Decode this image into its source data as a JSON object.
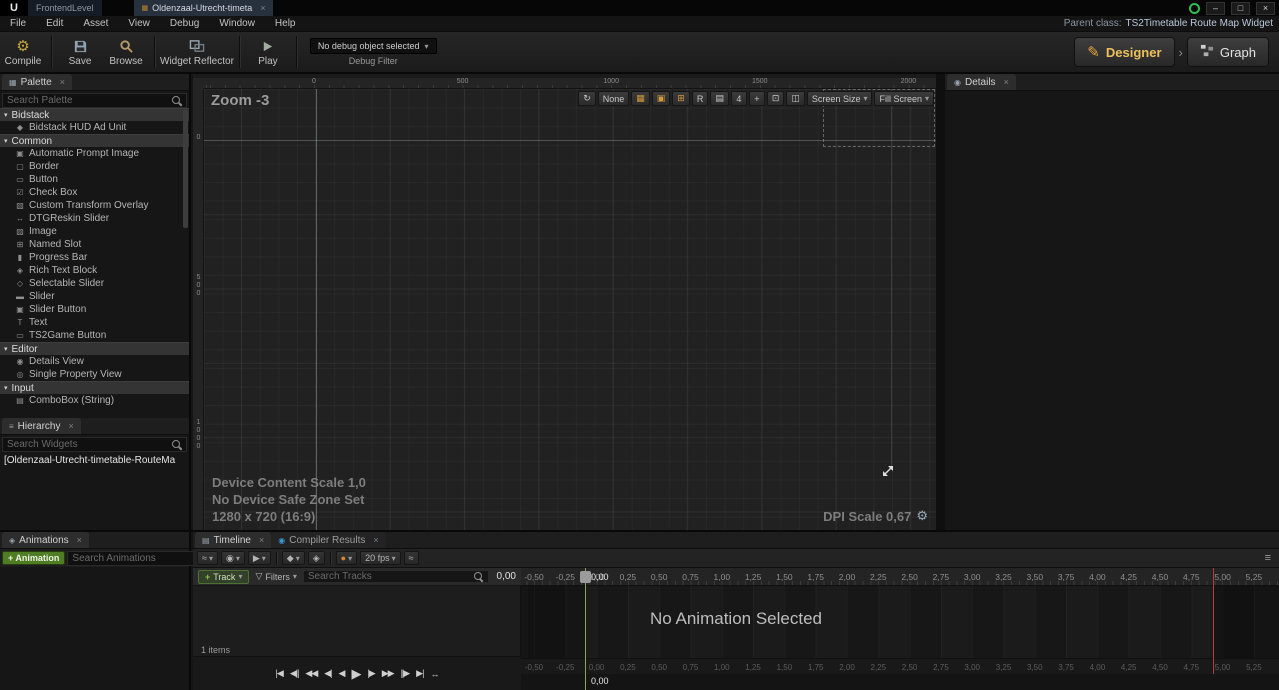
{
  "ui": {
    "caret": "▾",
    "close_glyph": "×",
    "tri": "▾",
    "plus": "+",
    "menu_glyph": "≡"
  },
  "titlebar": {
    "logo": "U",
    "tabs": [
      {
        "label": "FrontendLevel"
      },
      {
        "label": "Oldenzaal-Utrecht-timeta"
      }
    ],
    "window_controls": {
      "minimize": "–",
      "maximize": "□",
      "close": "×"
    }
  },
  "menubar": {
    "items": [
      "File",
      "Edit",
      "Asset",
      "View",
      "Debug",
      "Window",
      "Help"
    ],
    "parent_class_label": "Parent class:",
    "parent_class_value": "TS2Timetable Route Map Widget"
  },
  "toolbar": {
    "compile": "Compile",
    "save": "Save",
    "browse": "Browse",
    "widget_reflector": "Widget Reflector",
    "play": "Play",
    "debug_dropdown": "No debug object selected",
    "debug_filter": "Debug Filter",
    "designer": "Designer",
    "graph": "Graph"
  },
  "palette": {
    "tab": "Palette",
    "search_placeholder": "Search Palette",
    "groups": [
      {
        "label": "Bidstack",
        "items": [
          {
            "label": "Bidstack HUD Ad Unit",
            "glyph": "◆"
          }
        ]
      },
      {
        "label": "Common",
        "items": [
          {
            "label": "Automatic Prompt Image",
            "glyph": "▣"
          },
          {
            "label": "Border",
            "glyph": "▢"
          },
          {
            "label": "Button",
            "glyph": "▭"
          },
          {
            "label": "Check Box",
            "glyph": "☑"
          },
          {
            "label": "Custom Transform Overlay",
            "glyph": "▧"
          },
          {
            "label": "DTGReskin Slider",
            "glyph": "↔"
          },
          {
            "label": "Image",
            "glyph": "▨"
          },
          {
            "label": "Named Slot",
            "glyph": "⊞"
          },
          {
            "label": "Progress Bar",
            "glyph": "▮"
          },
          {
            "label": "Rich Text Block",
            "glyph": "◈"
          },
          {
            "label": "Selectable Slider",
            "glyph": "◇"
          },
          {
            "label": "Slider",
            "glyph": "▬"
          },
          {
            "label": "Slider Button",
            "glyph": "▣"
          },
          {
            "label": "Text",
            "glyph": "T"
          },
          {
            "label": "TS2Game Button",
            "glyph": "▭"
          }
        ]
      },
      {
        "label": "Editor",
        "items": [
          {
            "label": "Details View",
            "glyph": "◉"
          },
          {
            "label": "Single Property View",
            "glyph": "◎"
          }
        ]
      },
      {
        "label": "Input",
        "items": [
          {
            "label": "ComboBox (String)",
            "glyph": "▤"
          }
        ]
      }
    ]
  },
  "hierarchy": {
    "tab": "Hierarchy",
    "search_placeholder": "Search Widgets",
    "root_item": "[Oldenzaal-Utrecht-timetable-RouteMa"
  },
  "canvas": {
    "zoom_label": "Zoom -3",
    "top_ruler": [
      "0",
      "500",
      "1000",
      "1500",
      "2000"
    ],
    "left_ruler": [
      "0",
      "500",
      "1000"
    ],
    "toolbar": [
      {
        "name": "localization-preview-icon",
        "glyph": "↻"
      },
      {
        "name": "outline-mode-button",
        "label": "None"
      },
      {
        "name": "background-safe-icon",
        "glyph": "▦",
        "color": "#d29a3a"
      },
      {
        "name": "lock-icon",
        "glyph": "▣",
        "color": "#d29a3a"
      },
      {
        "name": "grid-snap-icon",
        "glyph": "⊞",
        "color": "#d29a3a"
      },
      {
        "name": "respect-locks-button",
        "label": "R"
      },
      {
        "name": "outlines-icon",
        "glyph": "▤"
      },
      {
        "name": "snap-grid-size-button",
        "label": "4"
      },
      {
        "name": "zoom-to-fit-icon",
        "glyph": "+"
      },
      {
        "name": "preview-background-icon",
        "glyph": "⊡"
      },
      {
        "name": "mirror-icon",
        "glyph": "◫"
      }
    ],
    "screen_size": "Screen Size",
    "fill_screen": "Fill Screen",
    "status_lines": [
      "Device Content Scale 1,0",
      "No Device Safe Zone Set",
      "1280 x 720 (16:9)"
    ],
    "dpi_label": "DPI Scale 0,67"
  },
  "details": {
    "tab": "Details"
  },
  "animations": {
    "tab": "Animations",
    "add_button": "+ Animation",
    "search_placeholder": "Search Animations"
  },
  "timeline": {
    "tabs": [
      {
        "label": "Timeline"
      },
      {
        "label": "Compiler Results"
      }
    ],
    "toolbar": [
      {
        "name": "curve-options-icon",
        "glyph": "≈",
        "caret": true
      },
      {
        "name": "view-options-icon",
        "glyph": "◉",
        "caret": true
      },
      {
        "name": "playback-options-icon",
        "glyph": "▶",
        "caret": true
      },
      {
        "sep": true
      },
      {
        "name": "key-options-icon",
        "glyph": "◆",
        "caret": true
      },
      {
        "name": "auto-key-icon",
        "glyph": "◈"
      },
      {
        "sep": true
      },
      {
        "name": "snap-options-icon",
        "glyph": "●",
        "color": "#cf8a2d",
        "caret": true
      },
      {
        "name": "fps-dropdown",
        "label": "20 fps",
        "caret": true
      },
      {
        "name": "curve-editor-toggle-icon",
        "glyph": "≈"
      }
    ],
    "track_button": "Track",
    "filters_label": "Filters",
    "search_placeholder": "Search Tracks",
    "current_time": "0,00",
    "no_animation": "No Animation Selected",
    "items_count": "1 items",
    "ticks": [
      "-0,50",
      "-0,25",
      "0,00",
      "0,25",
      "0,50",
      "0,75",
      "1,00",
      "1,25",
      "1,50",
      "1,75",
      "2,00",
      "2,25",
      "2,50",
      "2,75",
      "3,00",
      "3,25",
      "3,50",
      "3,75",
      "4,00",
      "4,25",
      "4,50",
      "4,75",
      "5,00",
      "5,25"
    ],
    "transport": [
      {
        "name": "to-front-button",
        "glyph": "|◀"
      },
      {
        "name": "step-backward-button",
        "glyph": "◀||"
      },
      {
        "name": "previous-key-button",
        "glyph": "◀◀"
      },
      {
        "name": "previous-frame-button",
        "glyph": "◀|"
      },
      {
        "name": "play-reverse-button",
        "glyph": "◀"
      },
      {
        "name": "play-button",
        "glyph": "▶"
      },
      {
        "name": "next-frame-button",
        "glyph": "|▶"
      },
      {
        "name": "next-key-button",
        "glyph": "▶▶"
      },
      {
        "name": "step-forward-button",
        "glyph": "||▶"
      },
      {
        "name": "to-end-button",
        "glyph": "▶|"
      },
      {
        "name": "loop-toggle-button",
        "glyph": "↔"
      }
    ]
  }
}
